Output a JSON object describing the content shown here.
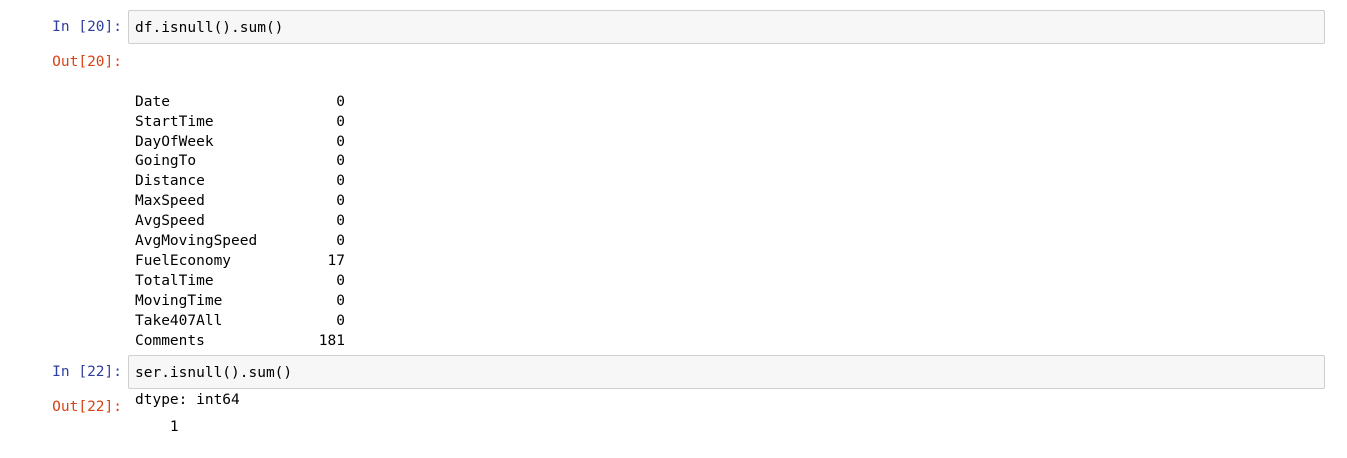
{
  "cells": [
    {
      "in_prompt": "In [20]:",
      "code": "df.isnull().sum()",
      "out_prompt": "Out[20]:",
      "output_rows": [
        {
          "name": "Date",
          "value": "0"
        },
        {
          "name": "StartTime",
          "value": "0"
        },
        {
          "name": "DayOfWeek",
          "value": "0"
        },
        {
          "name": "GoingTo",
          "value": "0"
        },
        {
          "name": "Distance",
          "value": "0"
        },
        {
          "name": "MaxSpeed",
          "value": "0"
        },
        {
          "name": "AvgSpeed",
          "value": "0"
        },
        {
          "name": "AvgMovingSpeed",
          "value": "0"
        },
        {
          "name": "FuelEconomy",
          "value": "17"
        },
        {
          "name": "TotalTime",
          "value": "0"
        },
        {
          "name": "MovingTime",
          "value": "0"
        },
        {
          "name": "Take407All",
          "value": "0"
        },
        {
          "name": "Comments",
          "value": "181"
        }
      ],
      "dtype": "dtype: int64"
    },
    {
      "in_prompt": "In [22]:",
      "code": "ser.isnull().sum()",
      "out_prompt": "Out[22]:",
      "output_text": "1"
    }
  ],
  "colors": {
    "in_prompt": "#303f9f",
    "out_prompt": "#d84315",
    "input_bg": "#f7f7f7",
    "input_border": "#cfcfcf"
  }
}
